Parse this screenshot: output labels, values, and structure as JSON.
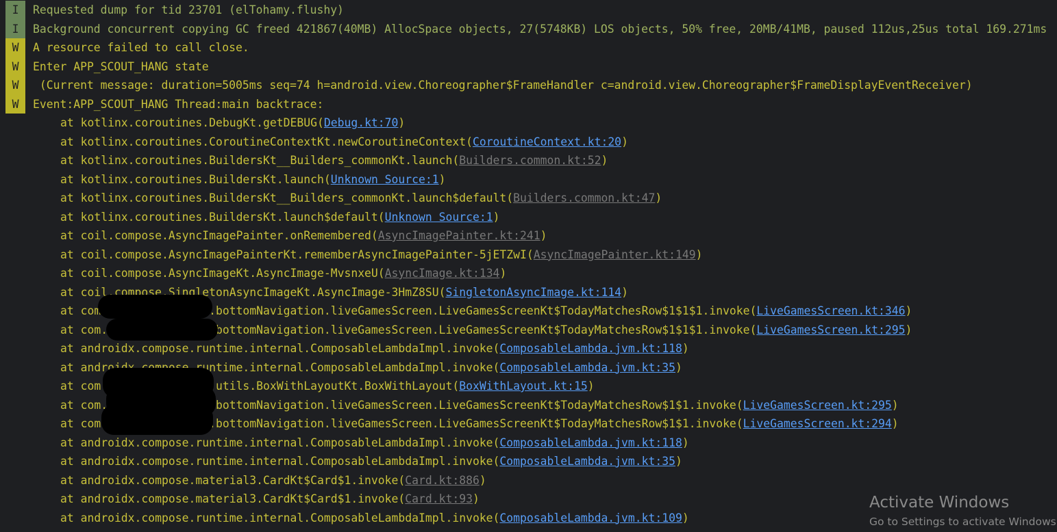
{
  "colors": {
    "background": "#1e1f22",
    "info_badge": "#6a8759",
    "warn_badge": "#bbb529",
    "info_text": "#9fb35f",
    "warn_text": "#c8c13a",
    "project_link": "#589df6",
    "library_link": "#787878"
  },
  "log_entries": [
    {
      "level": "I",
      "message": "Requested dump for tid 23701 (elTohamy.flushy)"
    },
    {
      "level": "I",
      "message": "Background concurrent copying GC freed 421867(40MB) AllocSpace objects, 27(5748KB) LOS objects, 50% free, 20MB/41MB, paused 112us,25us total 169.271ms"
    },
    {
      "level": "W",
      "message": "A resource failed to call close."
    },
    {
      "level": "W",
      "message": "Enter APP_SCOUT_HANG state"
    },
    {
      "level": "W",
      "message": " (Current message: duration=5005ms seq=74 h=android.view.Choreographer$FrameHandler c=android.view.Choreographer$FrameDisplayEventReceiver)"
    },
    {
      "level": "W",
      "message": "Event:APP_SCOUT_HANG Thread:main backtrace:"
    }
  ],
  "stack_frames": [
    {
      "prefix": "at kotlinx.coroutines.DebugKt.getDEBUG(",
      "link": "Debug.kt:70",
      "link_type": "project",
      "suffix": ")"
    },
    {
      "prefix": "at kotlinx.coroutines.CoroutineContextKt.newCoroutineContext(",
      "link": "CoroutineContext.kt:20",
      "link_type": "project",
      "suffix": ")"
    },
    {
      "prefix": "at kotlinx.coroutines.BuildersKt__Builders_commonKt.launch(",
      "link": "Builders.common.kt:52",
      "link_type": "library",
      "suffix": ")"
    },
    {
      "prefix": "at kotlinx.coroutines.BuildersKt.launch(",
      "link": "Unknown Source:1",
      "link_type": "project",
      "suffix": ")"
    },
    {
      "prefix": "at kotlinx.coroutines.BuildersKt__Builders_commonKt.launch$default(",
      "link": "Builders.common.kt:47",
      "link_type": "library",
      "suffix": ")"
    },
    {
      "prefix": "at kotlinx.coroutines.BuildersKt.launch$default(",
      "link": "Unknown Source:1",
      "link_type": "project",
      "suffix": ")"
    },
    {
      "prefix": "at coil.compose.AsyncImagePainter.onRemembered(",
      "link": "AsyncImagePainter.kt:241",
      "link_type": "library",
      "suffix": ")"
    },
    {
      "prefix": "at coil.compose.AsyncImagePainterKt.rememberAsyncImagePainter-5jETZwI(",
      "link": "AsyncImagePainter.kt:149",
      "link_type": "library",
      "suffix": ")"
    },
    {
      "prefix": "at coil.compose.AsyncImageKt.AsyncImage-MvsnxeU(",
      "link": "AsyncImage.kt:134",
      "link_type": "library",
      "suffix": ")"
    },
    {
      "prefix": "at coil.compose.SingletonAsyncImageKt.AsyncImage-3HmZ8SU(",
      "link": "SingletonAsyncImage.kt:114",
      "link_type": "project",
      "suffix": ")"
    },
    {
      "prefix": "at com.elTohamy.flushy.bottomNavigation.liveGamesScreen.LiveGamesScreenKt$TodayMatchesRow$1$1$1.invoke(",
      "link": "LiveGamesScreen.kt:346",
      "link_type": "project",
      "suffix": ")",
      "redacted": true
    },
    {
      "prefix": "at com.elTohamy.flushy.bottomNavigation.liveGamesScreen.LiveGamesScreenKt$TodayMatchesRow$1$1$1.invoke(",
      "link": "LiveGamesScreen.kt:295",
      "link_type": "project",
      "suffix": ")",
      "redacted": true
    },
    {
      "prefix": "at androidx.compose.runtime.internal.ComposableLambdaImpl.invoke(",
      "link": "ComposableLambda.jvm.kt:118",
      "link_type": "project",
      "suffix": ")"
    },
    {
      "prefix": "at androidx.compose.runtime.internal.ComposableLambdaImpl.invoke(",
      "link": "ComposableLambda.jvm.kt:35",
      "link_type": "project",
      "suffix": ")"
    },
    {
      "prefix": "at com.elTohamy.flushy.utils.BoxWithLayoutKt.BoxWithLayout(",
      "link": "BoxWithLayout.kt:15",
      "link_type": "project",
      "suffix": ")",
      "redacted": true
    },
    {
      "prefix": "at com.elTohamy.flushy.bottomNavigation.liveGamesScreen.LiveGamesScreenKt$TodayMatchesRow$1$1.invoke(",
      "link": "LiveGamesScreen.kt:295",
      "link_type": "project",
      "suffix": ")",
      "redacted": true
    },
    {
      "prefix": "at com.elTohamy.flushy.bottomNavigation.liveGamesScreen.LiveGamesScreenKt$TodayMatchesRow$1$1.invoke(",
      "link": "LiveGamesScreen.kt:294",
      "link_type": "project",
      "suffix": ")",
      "redacted": true
    },
    {
      "prefix": "at androidx.compose.runtime.internal.ComposableLambdaImpl.invoke(",
      "link": "ComposableLambda.jvm.kt:118",
      "link_type": "project",
      "suffix": ")"
    },
    {
      "prefix": "at androidx.compose.runtime.internal.ComposableLambdaImpl.invoke(",
      "link": "ComposableLambda.jvm.kt:35",
      "link_type": "project",
      "suffix": ")"
    },
    {
      "prefix": "at androidx.compose.material3.CardKt$Card$1.invoke(",
      "link": "Card.kt:886",
      "link_type": "library",
      "suffix": ")"
    },
    {
      "prefix": "at androidx.compose.material3.CardKt$Card$1.invoke(",
      "link": "Card.kt:93",
      "link_type": "library",
      "suffix": ")"
    },
    {
      "prefix": "at androidx.compose.runtime.internal.ComposableLambdaImpl.invoke(",
      "link": "ComposableLambda.jvm.kt:109",
      "link_type": "project",
      "suffix": ")"
    }
  ],
  "watermark": {
    "title": "Activate Windows",
    "subtitle": "Go to Settings to activate Windows."
  }
}
